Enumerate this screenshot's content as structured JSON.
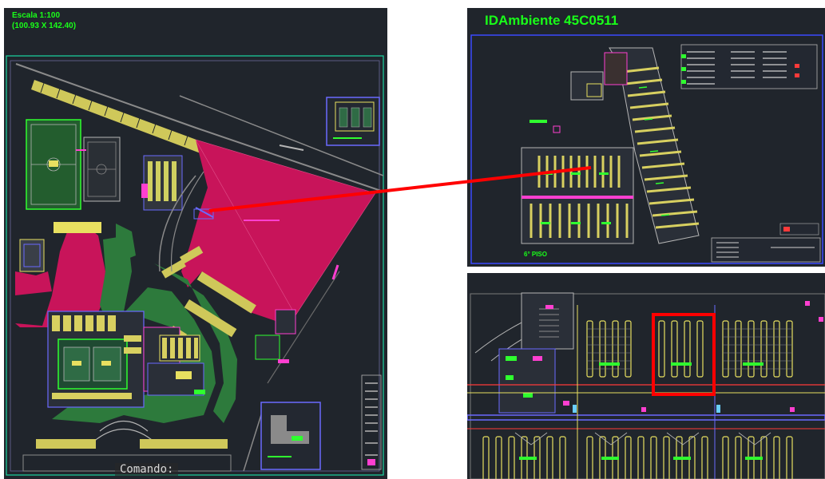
{
  "left_panel": {
    "scale_title": "Escala 1:100",
    "scale_dims": "(100.93 X 142.40)",
    "command_label": "Comando:"
  },
  "top_right_panel": {
    "title": "IDAmbiente 45C0511",
    "floor_label": "6° PISO"
  },
  "colors": {
    "background": "#20252c",
    "accent_green": "#19ff19",
    "parking_magenta": "#c8145a",
    "highlight_red": "#ff0000"
  }
}
